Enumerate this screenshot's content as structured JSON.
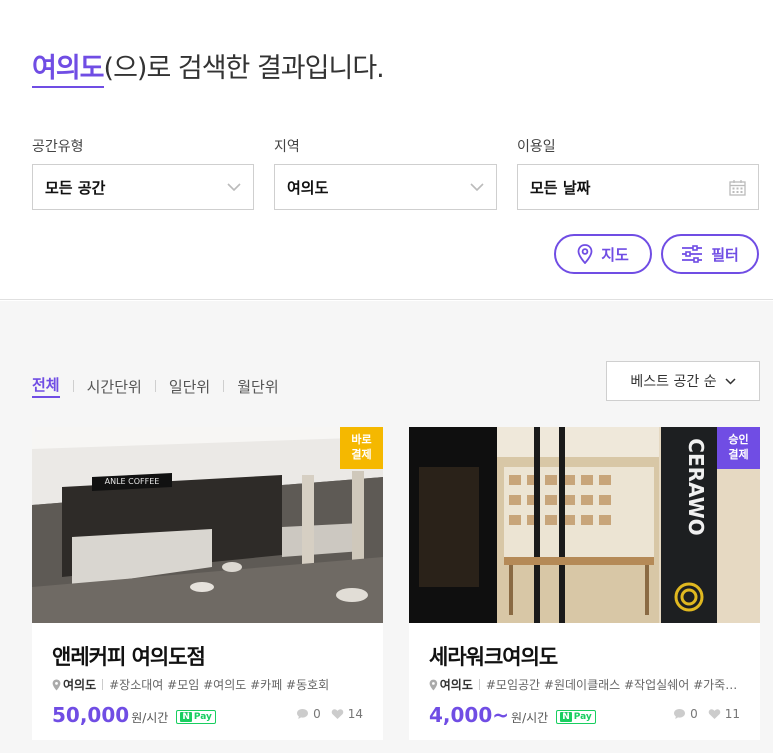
{
  "search": {
    "keyword": "여의도",
    "suffix": "(으)로 검색한 결과입니다."
  },
  "filters": {
    "space_type": {
      "label": "공간유형",
      "value": "모든 공간"
    },
    "region": {
      "label": "지역",
      "value": "여의도"
    },
    "date": {
      "label": "이용일",
      "value": "모든 날짜"
    }
  },
  "actions": {
    "map_label": "지도",
    "filter_label": "필터"
  },
  "tabs": [
    {
      "label": "전체",
      "active": true
    },
    {
      "label": "시간단위",
      "active": false
    },
    {
      "label": "일단위",
      "active": false
    },
    {
      "label": "월단위",
      "active": false
    }
  ],
  "sort": {
    "label": "베스트 공간 순"
  },
  "cards": [
    {
      "badge_line1": "바로",
      "badge_line2": "결제",
      "badge_color": "#f5b800",
      "title": "앤레커피 여의도점",
      "location": "여의도",
      "tags": "#장소대여 #모임 #여의도 #카페 #동호회",
      "price": "50,000",
      "unit": "원/시간",
      "pay_n": "N",
      "pay_label": "Pay",
      "comments": "0",
      "likes": "14",
      "sign_text": "ANLE COFFEE"
    },
    {
      "badge_line1": "승인",
      "badge_line2": "결제",
      "badge_color": "#704de4",
      "title": "세라워크여의도",
      "location": "여의도",
      "tags": "#모임공간 #원데이클래스 #작업실쉐어 #가죽공...",
      "price": "4,000~",
      "unit": "원/시간",
      "pay_n": "N",
      "pay_label": "Pay",
      "comments": "0",
      "likes": "11",
      "sign_text": "CERAWO"
    }
  ],
  "colors": {
    "accent": "#704de4",
    "badge_direct": "#f5b800",
    "badge_approve": "#704de4",
    "npay": "#19ce60"
  }
}
